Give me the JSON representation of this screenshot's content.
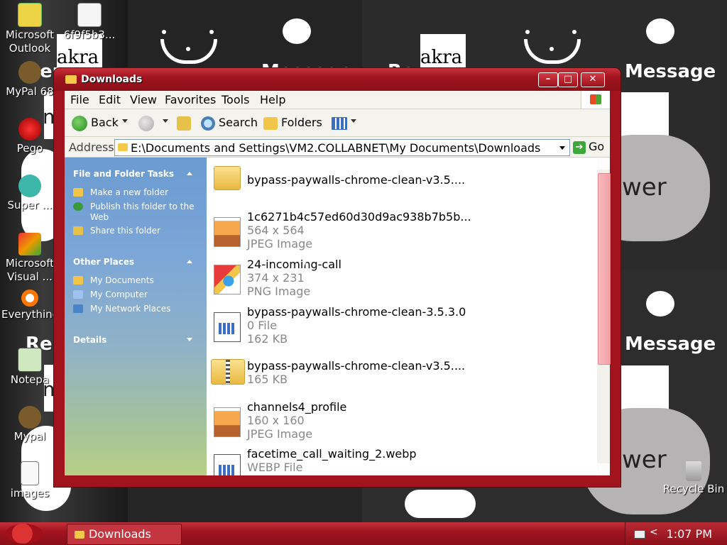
{
  "desktop": {
    "bg_texts": {
      "akra_left": "akra",
      "akra_right": "akra",
      "message_top_right": "Message",
      "message_mid_right": "Message",
      "message_top_center": "Message",
      "ren_left_1": "Ren",
      "ren_left_2": "Ren",
      "ren_center": "Ren",
      "wer_top": "wer",
      "wer_bottom": "wer",
      "m_left_1": "m",
      "m_left_2": "m"
    },
    "icons": [
      {
        "label": "Microsoft Outlook"
      },
      {
        "label": "6f9f5b3..."
      },
      {
        "label": "MyPal 68"
      },
      {
        "label": "Pego"
      },
      {
        "label": "Super ..."
      },
      {
        "label": "Microsoft Visual ..."
      },
      {
        "label": "Everything"
      },
      {
        "label": "Notepa"
      },
      {
        "label": "Mypal"
      },
      {
        "label": "images"
      },
      {
        "label": "Recycle Bin"
      }
    ]
  },
  "window": {
    "title": "Downloads",
    "controls": {
      "minimize": "–",
      "maximize": "□",
      "close": "✕"
    },
    "menu": [
      "File",
      "Edit",
      "View",
      "Favorites",
      "Tools",
      "Help"
    ],
    "toolbar": {
      "back": "Back",
      "search": "Search",
      "folders": "Folders"
    },
    "address": {
      "label": "Address",
      "value": "E:\\Documents and Settings\\VM2.COLLABNET\\My Documents\\Downloads",
      "go": "Go"
    },
    "tasks": {
      "file_folder_tasks": {
        "title": "File and Folder Tasks",
        "items": [
          "Make a new folder",
          "Publish this folder to the Web",
          "Share this folder"
        ]
      },
      "other_places": {
        "title": "Other Places",
        "items": [
          "My Documents",
          "My Computer",
          "My Network Places"
        ]
      },
      "details": {
        "title": "Details"
      }
    },
    "files": [
      {
        "name": "bypass-paywalls-chrome-clean-v3.5....",
        "line2": "",
        "line3": "",
        "icon": "folder-icon"
      },
      {
        "name": "1c6271b4c57ed60d30d9ac938b7b5b...",
        "line2": "564 x 564",
        "line3": "JPEG Image",
        "icon": "jpeg-icon"
      },
      {
        "name": "24-incoming-call",
        "line2": "374 x 231",
        "line3": "PNG Image",
        "icon": "png-icon"
      },
      {
        "name": "bypass-paywalls-chrome-clean-3.5.3.0",
        "line2": "0 File",
        "line3": "162 KB",
        "icon": "file-icon"
      },
      {
        "name": "bypass-paywalls-chrome-clean-v3.5....",
        "line2": "165 KB",
        "line3": "",
        "icon": "zip-folder-icon"
      },
      {
        "name": "channels4_profile",
        "line2": "160 x 160",
        "line3": "JPEG Image",
        "icon": "jpeg-icon"
      },
      {
        "name": "facetime_call_waiting_2.webp",
        "line2": "WEBP File",
        "line3": "",
        "icon": "file-icon"
      }
    ]
  },
  "taskbar": {
    "active_task": "Downloads",
    "clock": "1:07 PM",
    "tray_chevron": "<"
  },
  "colors": {
    "window_frame": "#a1141e",
    "taskbar": "#a1141e",
    "task_pane_top": "#6b9bd1",
    "scroll_thumb": "#f2a2a8"
  }
}
